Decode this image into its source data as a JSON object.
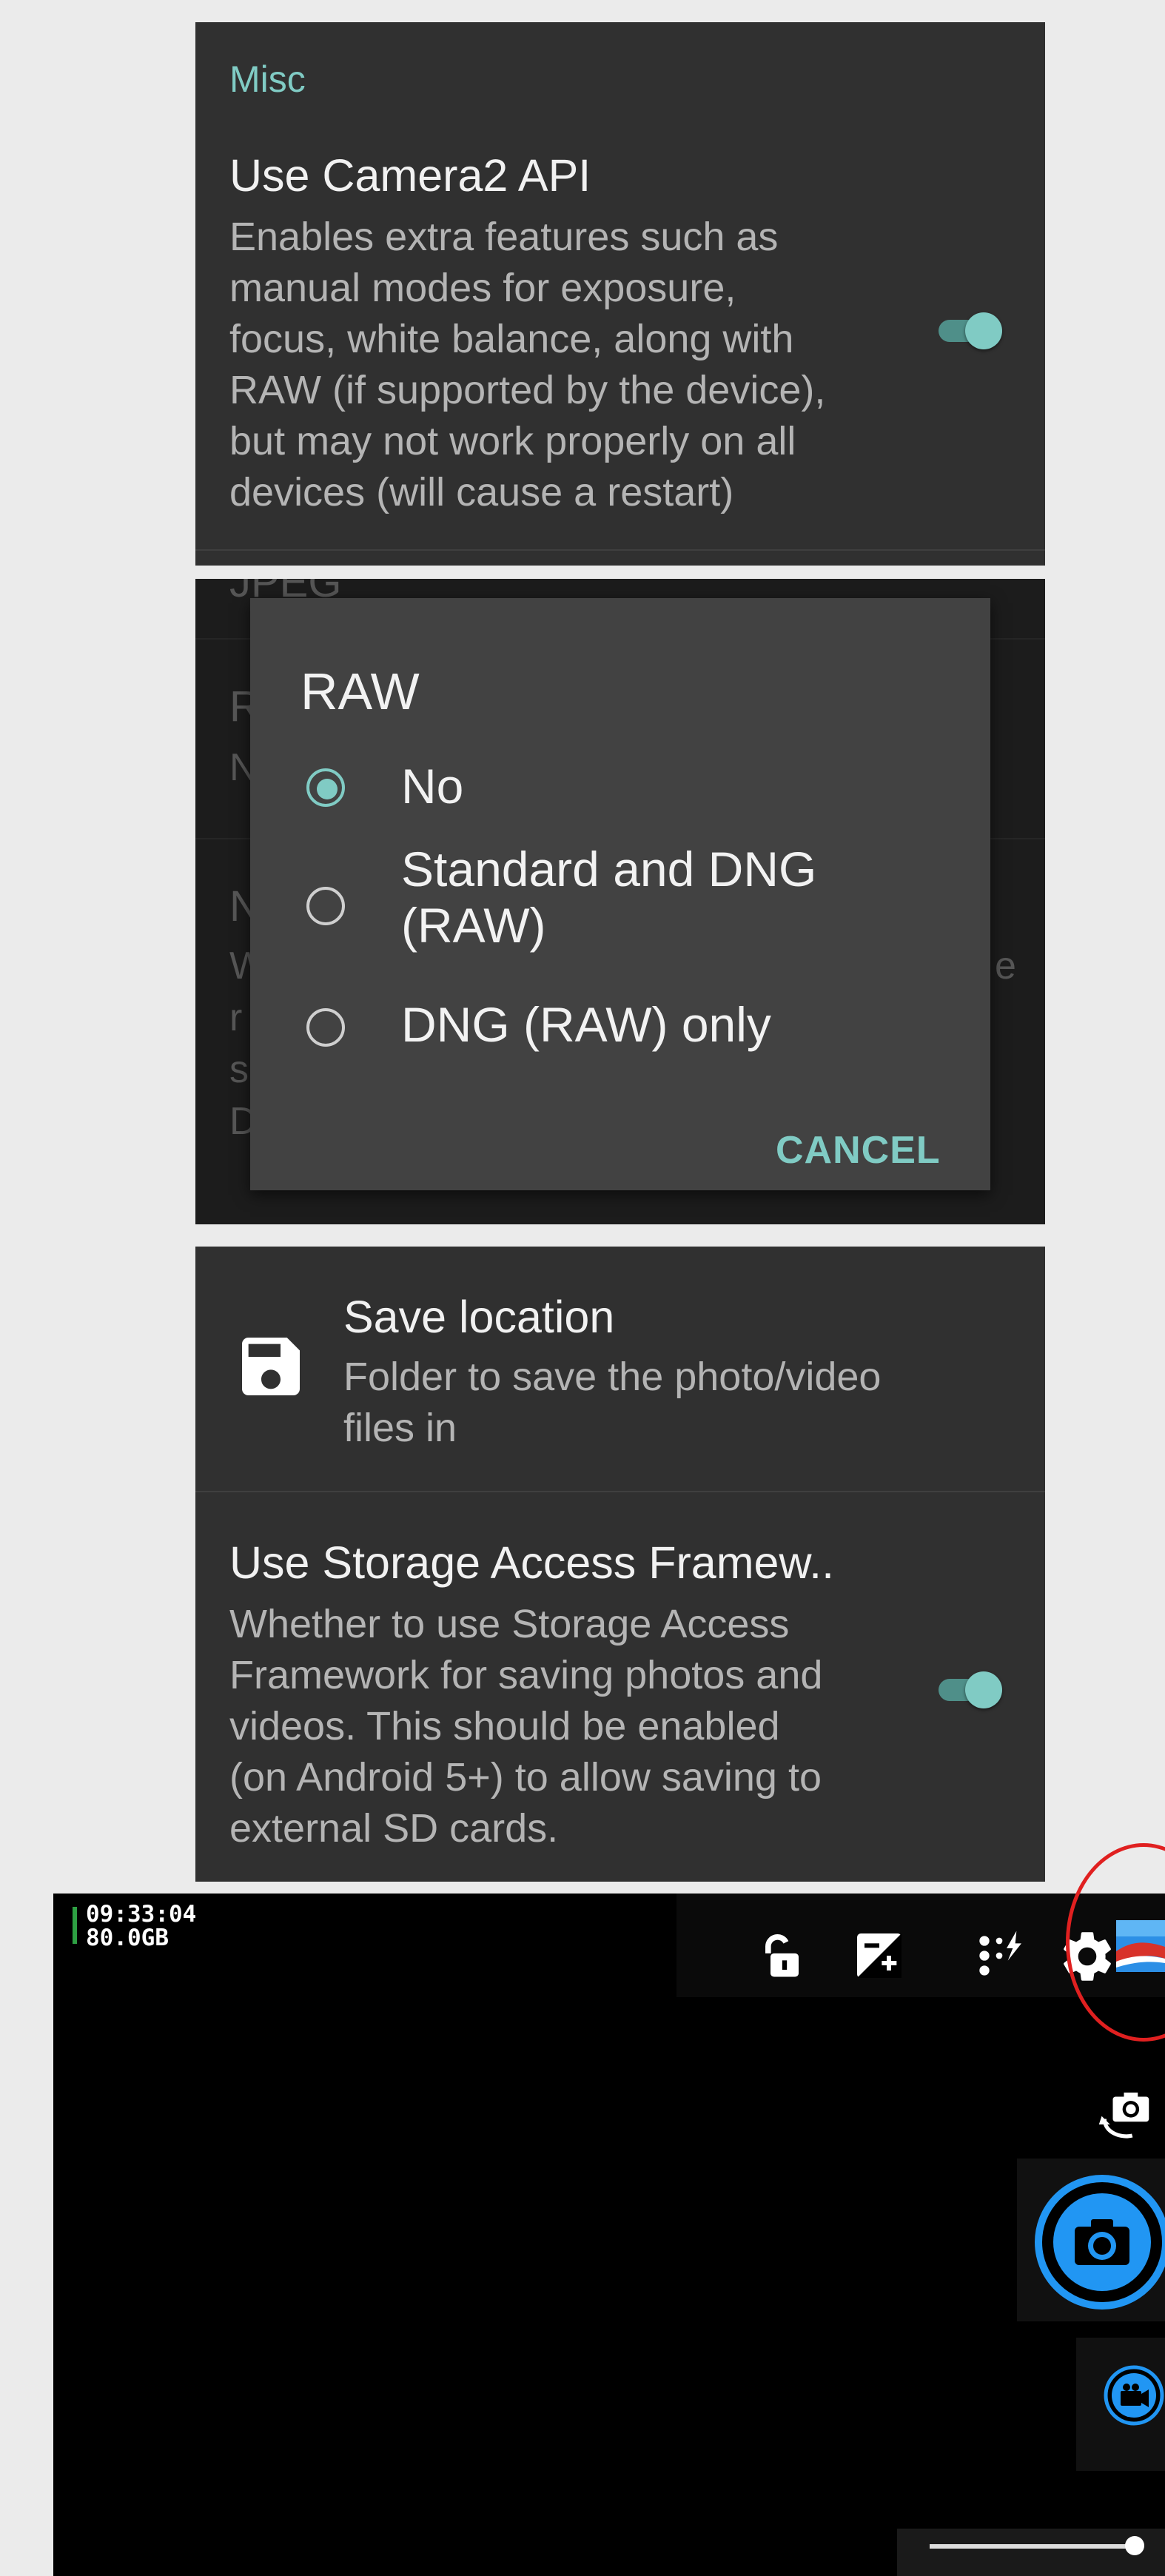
{
  "misc_panel": {
    "section_header": "Misc",
    "camera2": {
      "title": "Use Camera2 API",
      "summary_lines": [
        "Enables extra features such as",
        "manual modes for exposure,",
        "focus, white balance, along with",
        "RAW (if supported by the device),",
        "but may not work properly on all",
        "devices (will cause a restart)"
      ],
      "enabled": true
    }
  },
  "raw_dialog": {
    "title": "RAW",
    "options": [
      {
        "label_lines": [
          "No"
        ],
        "selected": true
      },
      {
        "label_lines": [
          "Standard and DNG",
          "(RAW)"
        ],
        "selected": false
      },
      {
        "label_lines": [
          "DNG (RAW) only"
        ],
        "selected": false
      }
    ],
    "cancel_label": "CANCEL",
    "background_fragments": {
      "top": "JPEG",
      "row1": [
        "R",
        "N"
      ],
      "row2": [
        "N",
        "W",
        "r",
        "s",
        "D"
      ],
      "right": "e"
    }
  },
  "storage_panel": {
    "save_location": {
      "title": "Save location",
      "summary_lines": [
        "Folder to save the photo/video",
        "files in"
      ],
      "icon": "floppy-disk-icon"
    },
    "saf": {
      "title": "Use Storage Access Framew..",
      "summary_lines": [
        "Whether to use Storage Access",
        "Framework for saving photos and",
        "videos. This should be enabled",
        "(on Android 5+) to allow saving to",
        "external SD cards."
      ],
      "enabled": true
    }
  },
  "camera_screen": {
    "time": "09:33:04",
    "free_space": "80.0GB",
    "toolbar_icons": [
      "lock-icon",
      "exposure-icon",
      "flash-icon",
      "settings-icon",
      "gallery-thumbnail-icon"
    ],
    "side_icons": [
      "switch-camera-icon",
      "take-photo-icon",
      "switch-video-icon"
    ],
    "highlight_color": "#e02020",
    "accent_color": "#80cbc4",
    "shutter_color": "#2196f3"
  }
}
